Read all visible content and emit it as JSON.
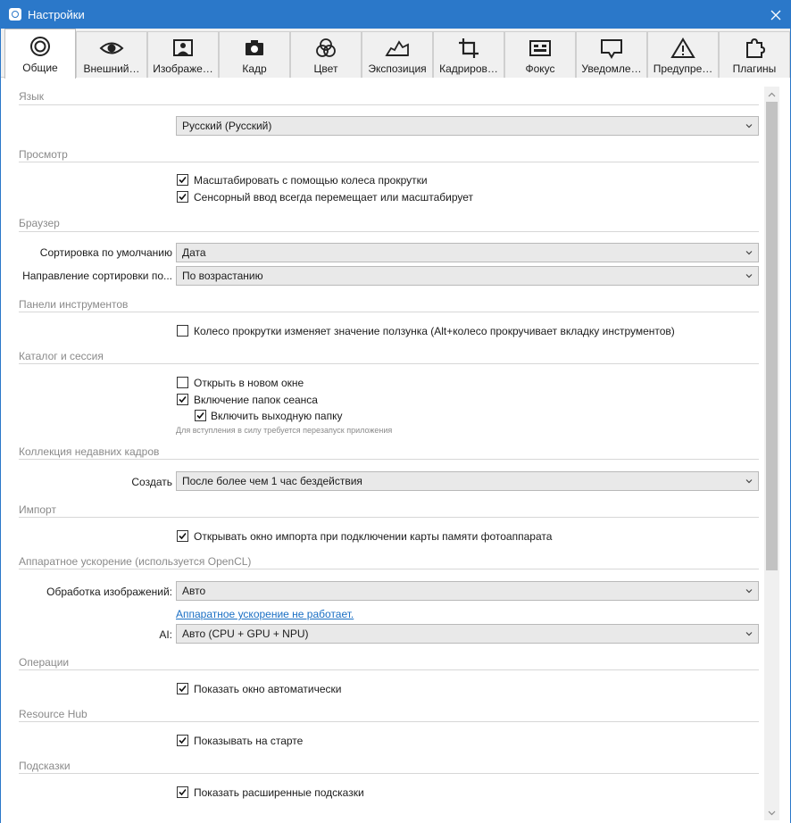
{
  "window": {
    "title": "Настройки"
  },
  "tabs": [
    {
      "label": "Общие",
      "icon": "general-icon"
    },
    {
      "label": "Внешний…",
      "icon": "eye-icon"
    },
    {
      "label": "Изображе…",
      "icon": "image-icon"
    },
    {
      "label": "Кадр",
      "icon": "camera-icon"
    },
    {
      "label": "Цвет",
      "icon": "color-circles-icon"
    },
    {
      "label": "Экспозиция",
      "icon": "exposure-icon"
    },
    {
      "label": "Кадриров…",
      "icon": "crop-icon"
    },
    {
      "label": "Фокус",
      "icon": "focus-icon"
    },
    {
      "label": "Уведомле…",
      "icon": "notification-icon"
    },
    {
      "label": "Предупре…",
      "icon": "warning-icon"
    },
    {
      "label": "Плагины",
      "icon": "plugin-icon"
    }
  ],
  "sections": {
    "language": {
      "title": "Язык",
      "value": "Русский (Русский)"
    },
    "view": {
      "title": "Просмотр",
      "zoom_wheel": "Масштабировать с помощью колеса прокрутки",
      "touch": "Сенсорный ввод всегда перемещает или масштабирует"
    },
    "browser": {
      "title": "Браузер",
      "sort_label": "Сортировка по умолчанию",
      "sort_value": "Дата",
      "dir_label": "Направление сортировки по...",
      "dir_value": "По возрастанию"
    },
    "toolbars": {
      "title": "Панели инструментов",
      "wheel": "Колесо прокрутки изменяет значение ползунка (Alt+колесо прокручивает вкладку инструментов)"
    },
    "catalog": {
      "title": "Каталог и сессия",
      "new_window": "Открыть в новом окне",
      "session_folders": "Включение папок сеанса",
      "output_folder": "Включить выходную папку",
      "hint": "Для вступления в силу требуется перезапуск приложения"
    },
    "recent": {
      "title": "Коллекция недавних кадров",
      "create_label": "Создать",
      "create_value": "После более чем 1 час бездействия"
    },
    "import": {
      "title": "Импорт",
      "open_import": "Открывать окно импорта при подключении карты памяти фотоаппарата"
    },
    "hardware": {
      "title": "Аппаратное ускорение (используется OpenCL)",
      "processing_label": "Обработка изображений:",
      "processing_value": "Авто",
      "link": "Аппаратное ускорение не работает.",
      "ai_label": "AI:",
      "ai_value": "Авто (CPU + GPU + NPU)"
    },
    "operations": {
      "title": "Операции",
      "show_auto": "Показать окно автоматически"
    },
    "resource_hub": {
      "title": "Resource Hub",
      "show_start": "Показывать на старте"
    },
    "tips": {
      "title": "Подсказки",
      "extended": "Показать расширенные подсказки"
    }
  }
}
